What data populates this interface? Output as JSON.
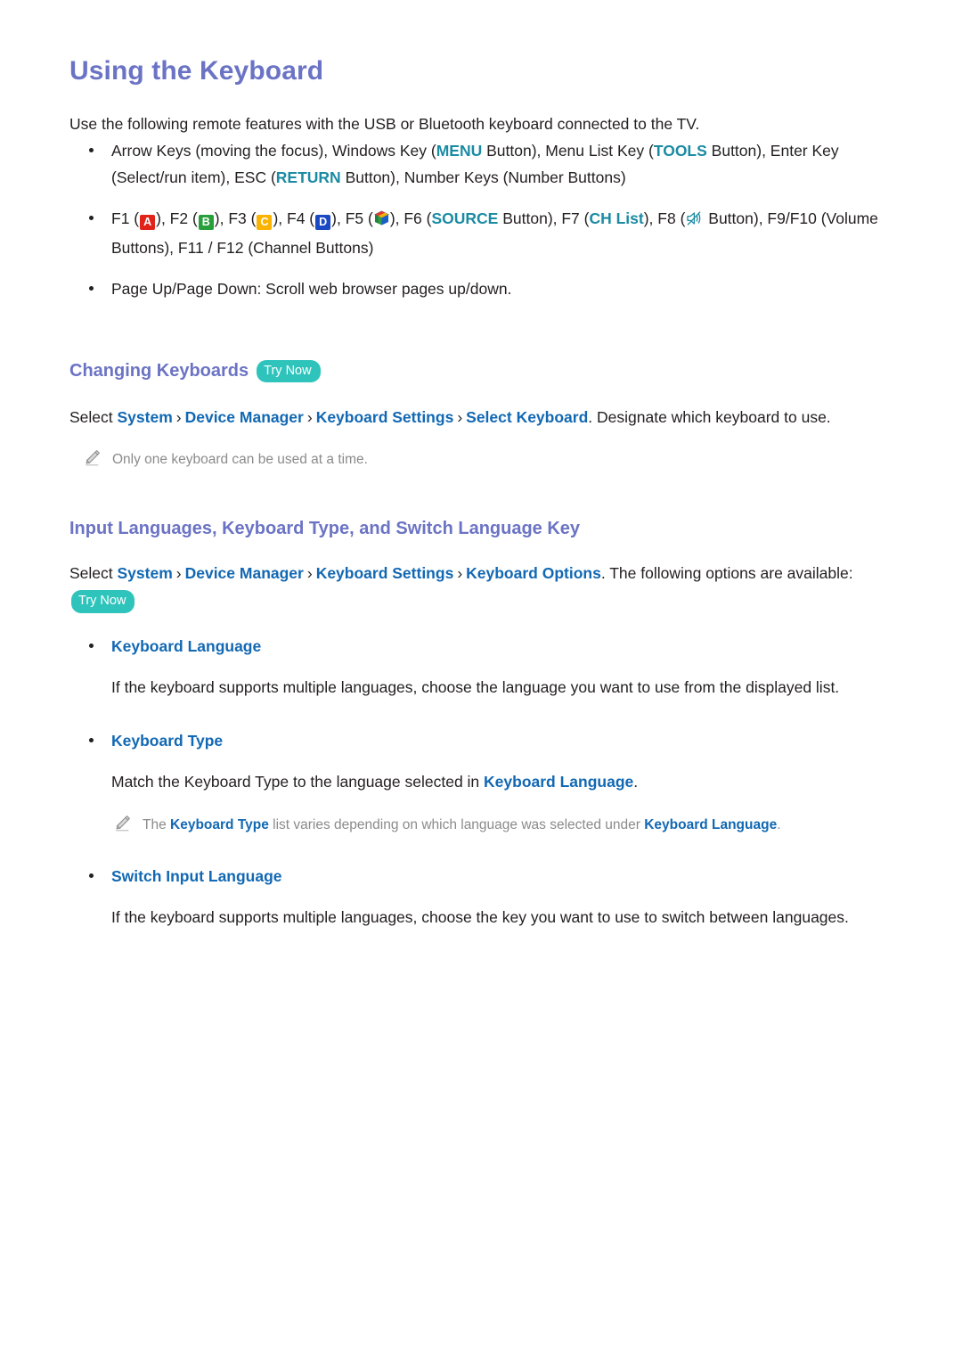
{
  "page": {
    "title": "Using the Keyboard",
    "intro": "Use the following remote features with the USB or Bluetooth keyboard connected to the TV."
  },
  "colors": {
    "heading_purple": "#6b73c4",
    "link_blue": "#1268b3",
    "remote_teal": "#1b8ba3",
    "badge_teal": "#2ec4bc",
    "key_a_red": "#e2231a",
    "key_b_green": "#27a03c",
    "key_c_yellow": "#f9b300",
    "key_d_blue": "#1b49c4",
    "note_gray": "#8b8b8b",
    "body_black": "#231f20"
  },
  "bullets": {
    "arrow_keys": {
      "p1": "Arrow Keys (moving the focus), Windows Key (",
      "menu": "MENU",
      "p2": " Button), Menu List Key (",
      "tools": "TOOLS",
      "p3": " Button), Enter Key (Select/run item), ESC (",
      "return": "RETURN",
      "p4": " Button), Number Keys (Number Buttons)"
    },
    "function_keys": {
      "f1": "F1 (",
      "key_a": "A",
      "f2": "), F2 (",
      "key_b": "B",
      "f3": "), F3 (",
      "key_c": "C",
      "f4": "), F4 (",
      "key_d": "D",
      "f5": "), F5 (",
      "f6": "), F6 (",
      "source": "SOURCE",
      "f7": " Button), F7 (",
      "chlist": "CH List",
      "f8": "), F8 (",
      "f8_tail": " Button), F9/F10 (Volume Buttons), F11 / F12 (Channel Buttons)"
    },
    "page_keys": "Page Up/Page Down: Scroll web browser pages up/down."
  },
  "section_changing": {
    "title": "Changing Keyboards",
    "try_now": "Try Now",
    "path": {
      "select": "Select ",
      "i1": "System",
      "i2": "Device Manager",
      "i3": "Keyboard Settings",
      "i4": "Select Keyboard",
      "tail": ". Designate which keyboard to use."
    },
    "note": "Only one keyboard can be used at a time."
  },
  "section_input": {
    "title": "Input Languages, Keyboard Type, and Switch Language Key",
    "try_now": "Try Now",
    "path": {
      "select": "Select ",
      "i1": "System",
      "i2": "Device Manager",
      "i3": "Keyboard Settings",
      "i4": "Keyboard Options",
      "tail": ". The following options are available: "
    },
    "options": [
      {
        "label": "Keyboard Language",
        "desc": "If the keyboard supports multiple languages, choose the language you want to use from the displayed list."
      },
      {
        "label": "Keyboard Type",
        "desc_p1": "Match the Keyboard Type to the language selected in ",
        "desc_link": "Keyboard Language",
        "desc_p2": ".",
        "note_p1": "The ",
        "note_l1": "Keyboard Type",
        "note_p2": " list varies depending on which language was selected under ",
        "note_l2": "Keyboard Language",
        "note_p3": "."
      },
      {
        "label": "Switch Input Language",
        "desc": "If the keyboard supports multiple languages, choose the key you want to use to switch between languages."
      }
    ]
  },
  "icons": {
    "smart_hub": "smart-hub-cube-icon",
    "mute": "mute-speaker-icon",
    "pencil": "pencil-note-icon",
    "chevron": "›"
  }
}
